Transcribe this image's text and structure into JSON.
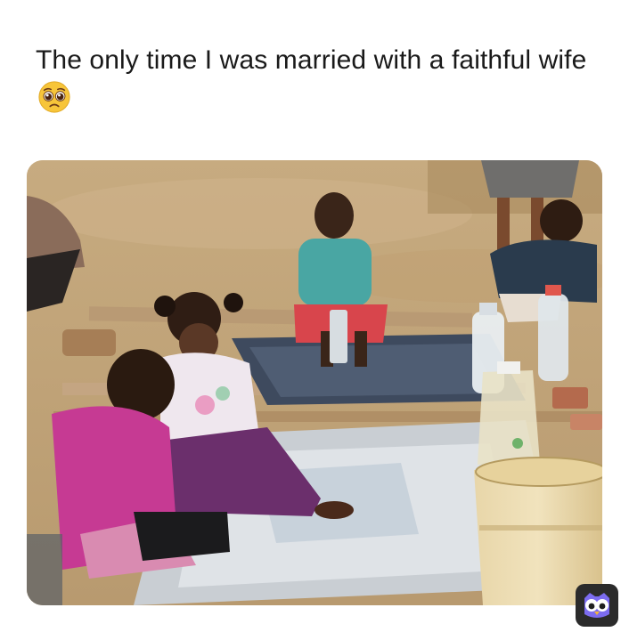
{
  "caption": {
    "text": "The only time I was married with a faithful wife",
    "emoji": "pleading-face"
  },
  "photo": {
    "description_icon": "photo",
    "corner_radius_style": "rounded"
  },
  "watermark": {
    "icon": "owl-logo"
  },
  "colors": {
    "background": "#ffffff",
    "caption_text": "#1a1a1a",
    "emoji_yellow": "#f7c53a",
    "watermark_bg": "#2b2b2b",
    "watermark_owl": "#7c6cf0"
  }
}
